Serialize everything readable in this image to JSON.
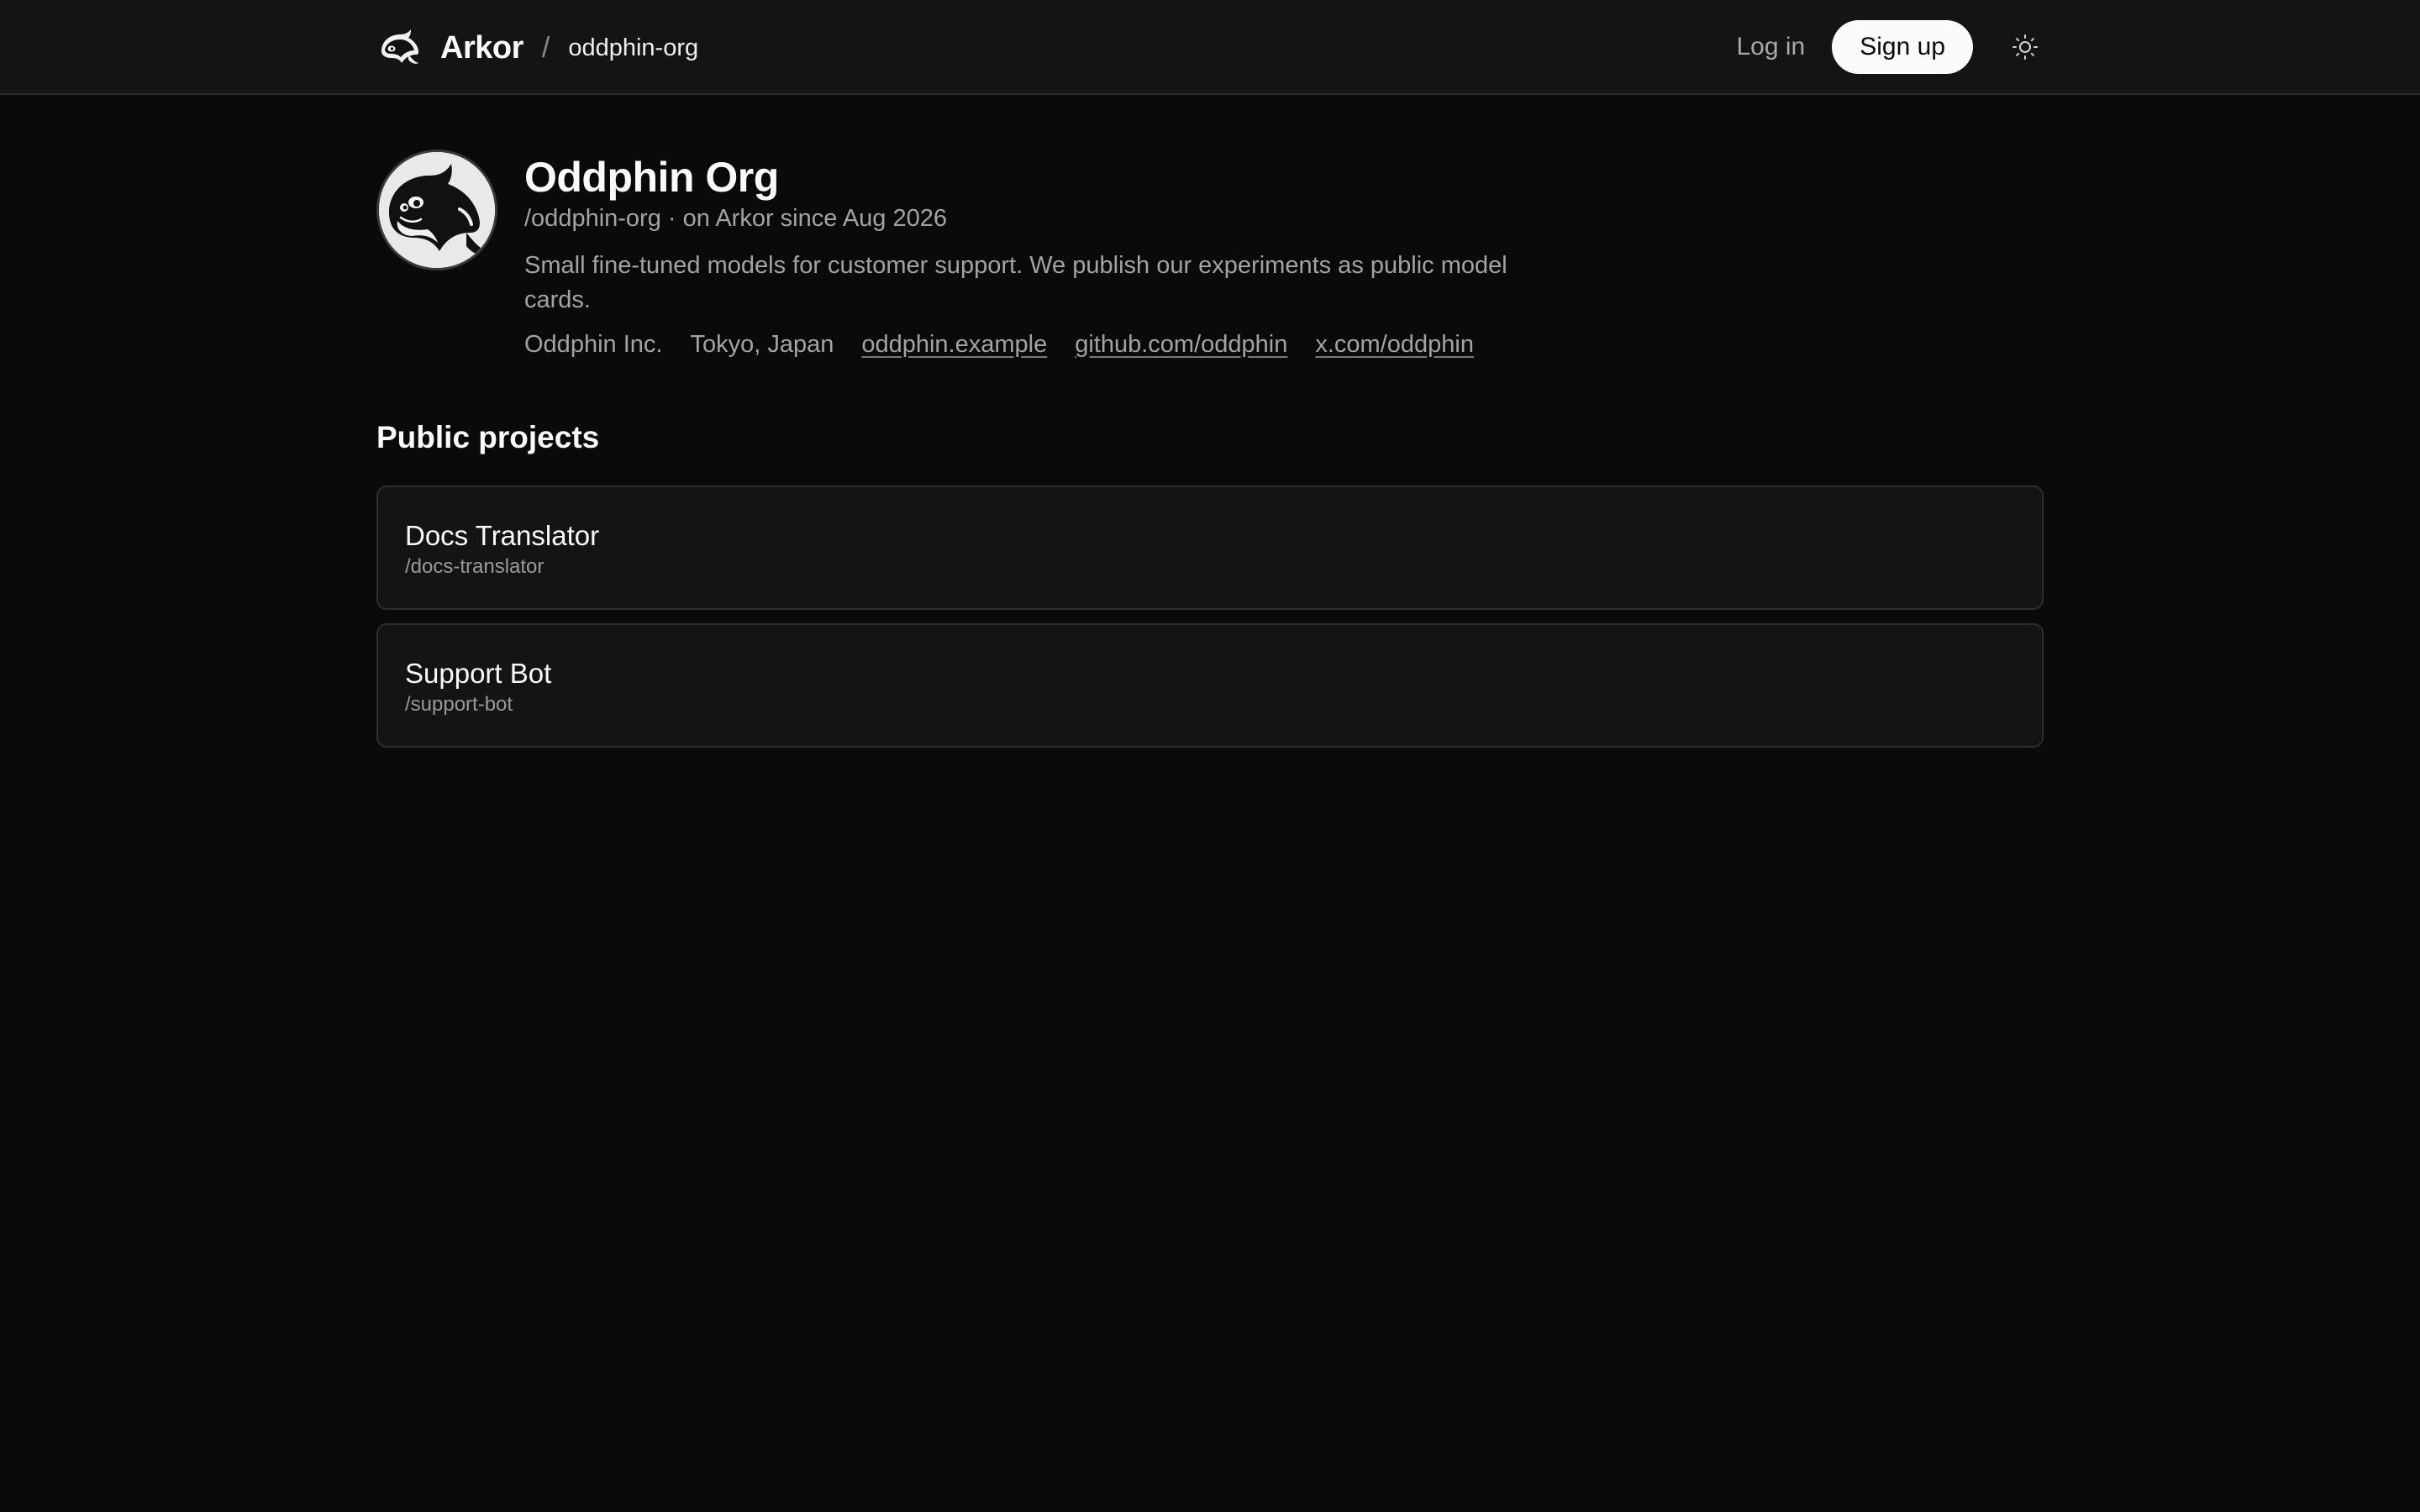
{
  "header": {
    "brand_name": "Arkor",
    "breadcrumb_sep": "/",
    "breadcrumb": "oddphin-org",
    "login_label": "Log in",
    "signup_label": "Sign up",
    "brand_icon": "orca-logo-icon",
    "theme_icon": "sun-icon"
  },
  "profile": {
    "name": "Oddphin Org",
    "meta": "/oddphin-org · on Arkor since Aug 2026",
    "description": "Small fine-tuned models for customer support. We publish our experiments as public model cards.",
    "company": "Oddphin Inc.",
    "location": "Tokyo, Japan",
    "website": "oddphin.example",
    "github": "github.com/oddphin",
    "x": "x.com/oddphin",
    "avatar_icon": "orca-avatar-icon"
  },
  "projects": {
    "title": "Public projects",
    "items": [
      {
        "name": "Docs Translator",
        "slug": "/docs-translator"
      },
      {
        "name": "Support Bot",
        "slug": "/support-bot"
      }
    ]
  },
  "colors": {
    "background": "#0a0a0a",
    "header_bg": "#141414",
    "card_bg": "#141414",
    "text_primary": "#fafafa",
    "text_muted": "#a3a3a3",
    "button_bg": "#fafafa"
  }
}
